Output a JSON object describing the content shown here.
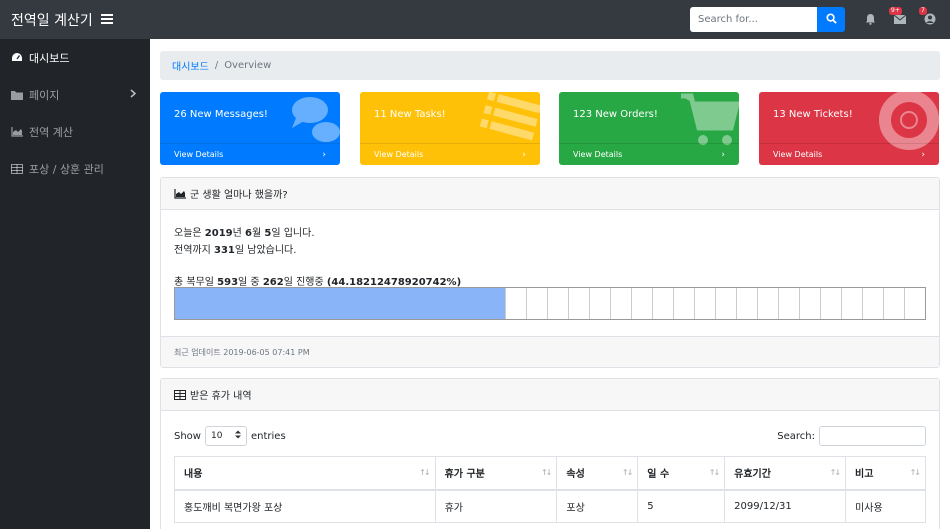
{
  "app": {
    "title": "전역일 계산기"
  },
  "search": {
    "placeholder": "Search for..."
  },
  "notifications": {
    "alerts_badge": "9+",
    "messages_badge": "7"
  },
  "sidebar": {
    "items": [
      {
        "label": "대시보드",
        "icon": "tachometer-icon"
      },
      {
        "label": "페이지",
        "icon": "folder-icon"
      },
      {
        "label": "전역 계산",
        "icon": "area-chart-icon"
      },
      {
        "label": "포상 / 상훈 관리",
        "icon": "table-icon"
      }
    ]
  },
  "breadcrumb": {
    "link": "대시보드",
    "current": "Overview"
  },
  "cards": [
    {
      "text": "26 New Messages!",
      "footer": "View Details",
      "color": "#007bff",
      "icon": "comments-icon"
    },
    {
      "text": "11 New Tasks!",
      "footer": "View Details",
      "color": "#ffc107",
      "icon": "list-icon"
    },
    {
      "text": "123 New Orders!",
      "footer": "View Details",
      "color": "#28a745",
      "icon": "shopping-cart-icon"
    },
    {
      "text": "13 New Tickets!",
      "footer": "View Details",
      "color": "#dc3545",
      "icon": "life-ring-icon"
    }
  ],
  "progress_panel": {
    "title": "군 생활 얼마나 했을까?",
    "line1": {
      "pre": "오늘은 ",
      "b1": "2019",
      "t1": "년 ",
      "b2": "6",
      "t2": "월 ",
      "b3": "5",
      "t3": "일 입니다."
    },
    "line2": {
      "pre": "전역까지 ",
      "b1": "331",
      "t1": "일 남았습니다."
    },
    "line3": {
      "pre": "총 복무일 ",
      "b1": "593",
      "t1": "일 중 ",
      "b2": "262",
      "t2": "일 진행중 ",
      "b3": "(44.18212478920742%)"
    },
    "percent": 44.18212478920742,
    "footer": "최근 업데이트 2019-06-05 07:41 PM"
  },
  "leave_panel": {
    "title": "받은 휴가 내역",
    "show_label": "Show",
    "length_value": "10",
    "entries_label": "entries",
    "search_label": "Search:",
    "columns": [
      "내용",
      "휴가 구분",
      "속성",
      "일 수",
      "유효기간",
      "비고"
    ],
    "rows": [
      [
        "홍도깨비 복면가왕 포상",
        "휴가",
        "포상",
        "5",
        "2099/12/31",
        "미사용"
      ]
    ]
  }
}
